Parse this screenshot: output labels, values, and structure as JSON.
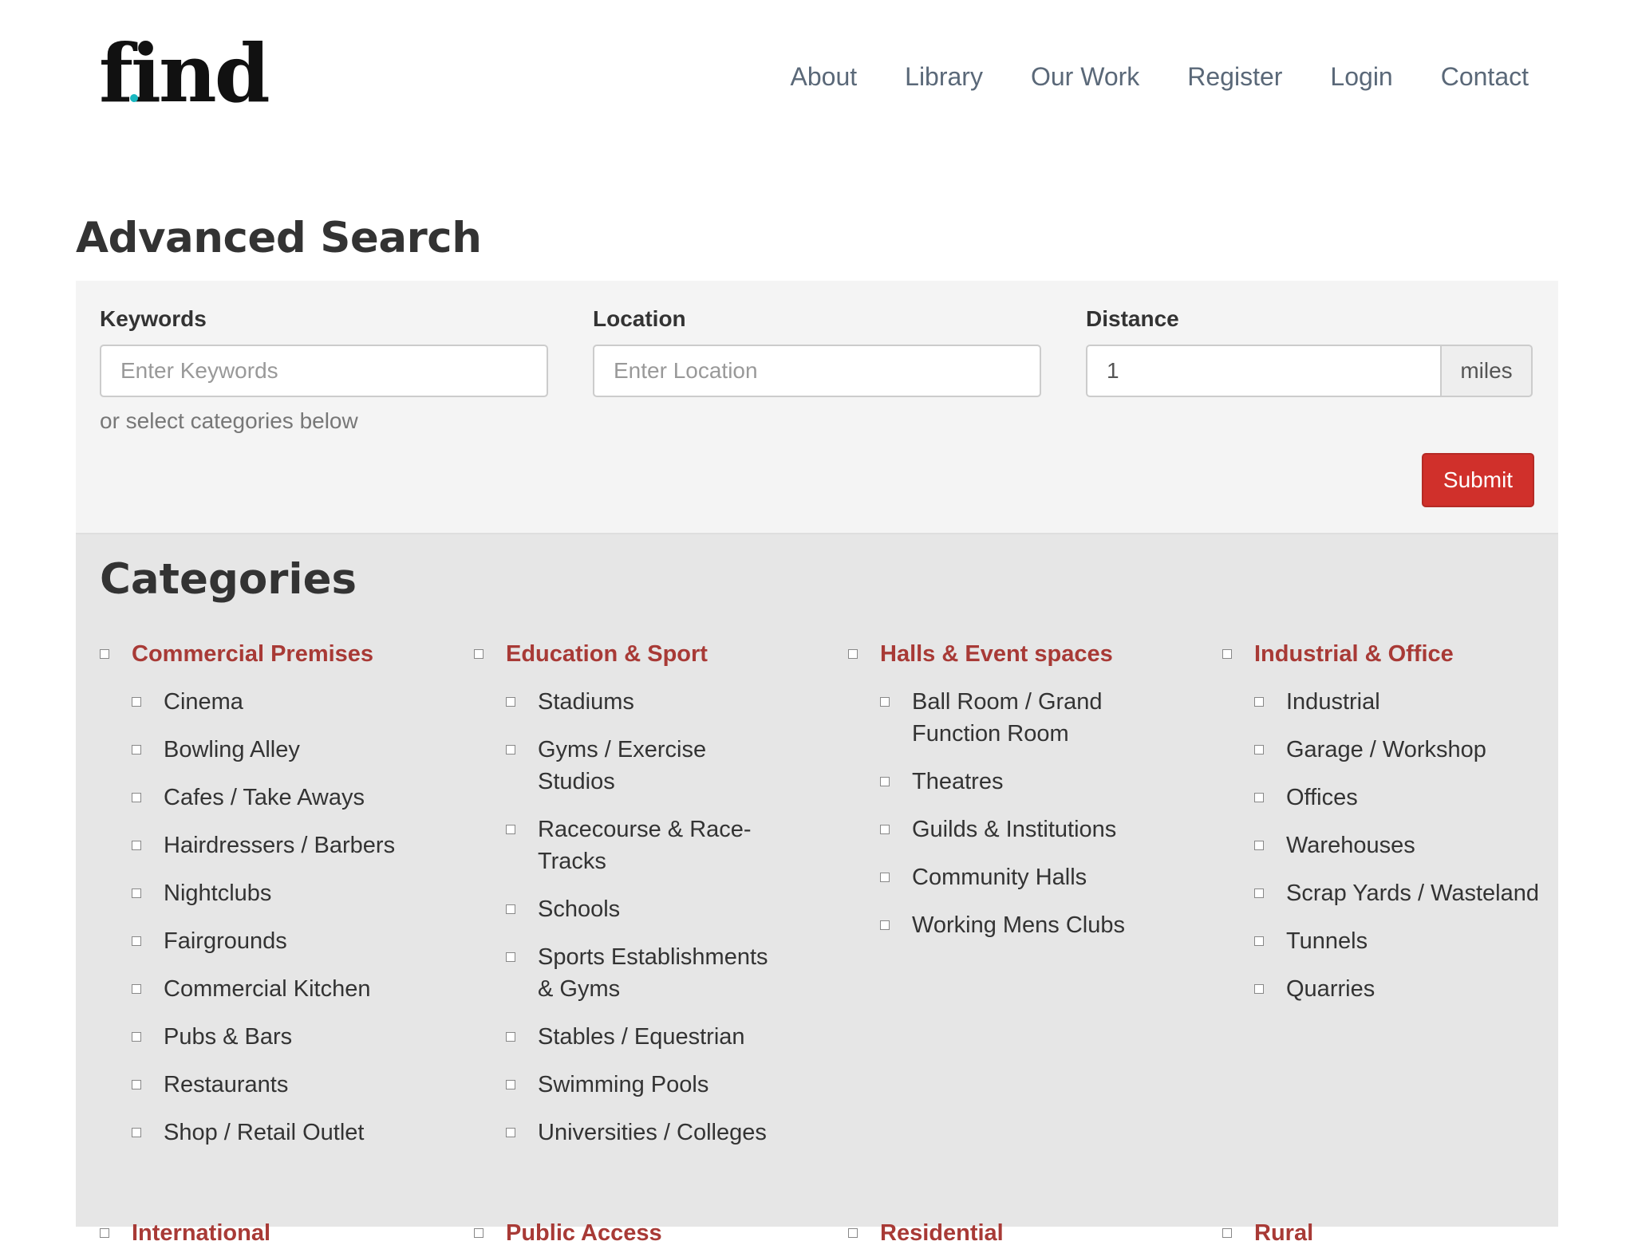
{
  "header": {
    "logo_text": "find",
    "nav": [
      "About",
      "Library",
      "Our Work",
      "Register",
      "Login",
      "Contact"
    ]
  },
  "page_title": "Advanced Search",
  "search": {
    "keywords_label": "Keywords",
    "keywords_placeholder": "Enter Keywords",
    "location_label": "Location",
    "location_placeholder": "Enter Location",
    "distance_label": "Distance",
    "distance_value": "1",
    "distance_unit": "miles",
    "helper_text": "or select categories below",
    "submit_label": "Submit"
  },
  "categories": {
    "title": "Categories",
    "groups": [
      {
        "name": "Commercial Premises",
        "items": [
          "Cinema",
          "Bowling Alley",
          "Cafes / Take Aways",
          "Hairdressers / Barbers",
          "Nightclubs",
          "Fairgrounds",
          "Commercial Kitchen",
          "Pubs & Bars",
          "Restaurants",
          "Shop / Retail Outlet"
        ]
      },
      {
        "name": "Education & Sport",
        "items": [
          "Stadiums",
          "Gyms / Exercise Studios",
          "Racecourse & Race-Tracks",
          "Schools",
          "Sports Establishments & Gyms",
          "Stables / Equestrian",
          "Swimming Pools",
          "Universities / Colleges"
        ]
      },
      {
        "name": "Halls & Event spaces",
        "items": [
          "Ball Room / Grand Function Room",
          "Theatres",
          "Guilds & Institutions",
          "Community Halls",
          "Working Mens Clubs"
        ]
      },
      {
        "name": "Industrial & Office",
        "items": [
          "Industrial",
          "Garage / Workshop",
          "Offices",
          "Warehouses",
          "Scrap Yards / Wasteland",
          "Tunnels",
          "Quarries"
        ]
      }
    ],
    "bottom_groups": [
      "International",
      "Public Access",
      "Residential",
      "Rural"
    ]
  },
  "colors": {
    "accent_red": "#a83a36",
    "button_red": "#d0302b",
    "logo_dot": "#19b7c0"
  }
}
